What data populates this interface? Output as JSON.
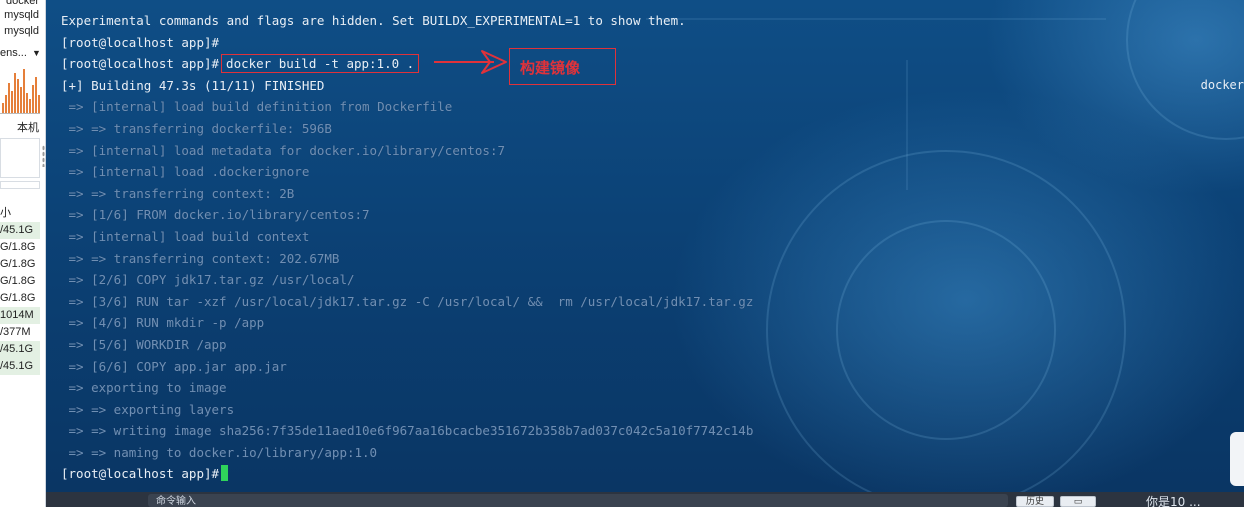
{
  "left_panel": {
    "top_items": [
      "docker",
      "mysqld",
      "mysqld"
    ],
    "dropdown_label": "ens...",
    "local_label": "本机",
    "size_header": "小",
    "sizes": [
      "/45.1G",
      "G/1.8G",
      "G/1.8G",
      "G/1.8G",
      "G/1.8G",
      "1014M",
      "/377M",
      "/45.1G",
      "/45.1G"
    ]
  },
  "terminal": {
    "line_experimental": "Experimental commands and flags are hidden. Set BUILDX_EXPERIMENTAL=1 to show them.",
    "prompt": "[root@localhost app]#",
    "command": "docker build -t app:1.0 .",
    "building": "[+] Building 47.3s (11/11) FINISHED",
    "build_steps": [
      " => [internal] load build definition from Dockerfile",
      " => => transferring dockerfile: 596B",
      " => [internal] load metadata for docker.io/library/centos:7",
      " => [internal] load .dockerignore",
      " => => transferring context: 2B",
      " => [1/6] FROM docker.io/library/centos:7",
      " => [internal] load build context",
      " => => transferring context: 202.67MB",
      " => [2/6] COPY jdk17.tar.gz /usr/local/",
      " => [3/6] RUN tar -xzf /usr/local/jdk17.tar.gz -C /usr/local/ &&  rm /usr/local/jdk17.tar.gz",
      " => [4/6] RUN mkdir -p /app",
      " => [5/6] WORKDIR /app",
      " => [6/6] COPY app.jar app.jar",
      " => exporting to image",
      " => => exporting layers",
      " => => writing image sha256:7f35de11aed10e6f967aa16bcacbe351672b358b7ad037c042c5a10f7742c14b",
      " => => naming to docker.io/library/app:1.0"
    ],
    "right_label": "docker"
  },
  "annotation": {
    "label": "构建镜像",
    "color": "#e0323a"
  },
  "bottom_bar": {
    "input_placeholder": "命令输入",
    "history_button": "历史",
    "status_text": "你是10 ..."
  }
}
